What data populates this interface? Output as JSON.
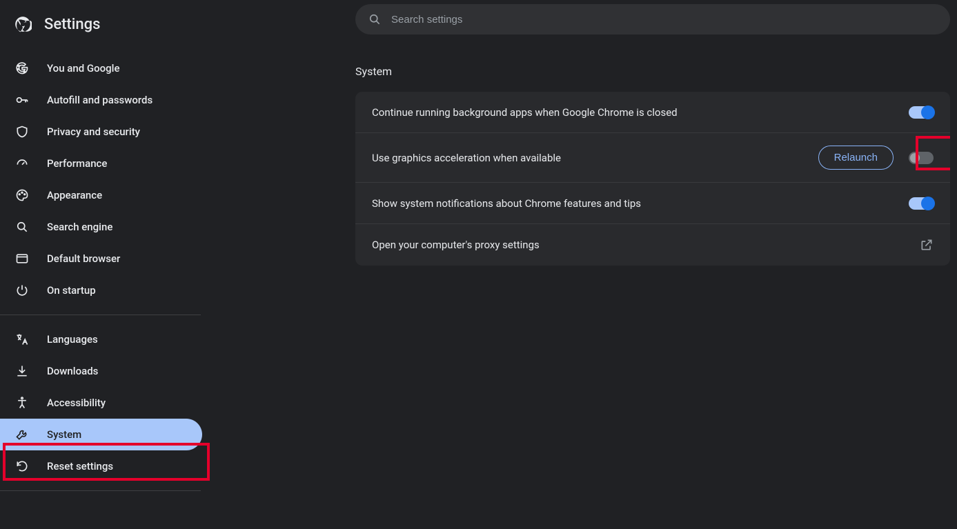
{
  "sidebar": {
    "title": "Settings",
    "groups": [
      {
        "items": [
          {
            "id": "you-google",
            "label": "You and Google",
            "icon": "google"
          },
          {
            "id": "autofill",
            "label": "Autofill and passwords",
            "icon": "key"
          },
          {
            "id": "privacy",
            "label": "Privacy and security",
            "icon": "shield"
          },
          {
            "id": "performance",
            "label": "Performance",
            "icon": "speedometer"
          },
          {
            "id": "appearance",
            "label": "Appearance",
            "icon": "palette"
          },
          {
            "id": "search-engine",
            "label": "Search engine",
            "icon": "search"
          },
          {
            "id": "default-browser",
            "label": "Default browser",
            "icon": "browser"
          },
          {
            "id": "on-startup",
            "label": "On startup",
            "icon": "power"
          }
        ]
      },
      {
        "items": [
          {
            "id": "languages",
            "label": "Languages",
            "icon": "translate"
          },
          {
            "id": "downloads",
            "label": "Downloads",
            "icon": "download"
          },
          {
            "id": "accessibility",
            "label": "Accessibility",
            "icon": "accessibility"
          },
          {
            "id": "system",
            "label": "System",
            "icon": "wrench",
            "selected": true
          },
          {
            "id": "reset",
            "label": "Reset settings",
            "icon": "reset"
          }
        ]
      }
    ]
  },
  "search": {
    "placeholder": "Search settings",
    "value": ""
  },
  "section": {
    "title": "System",
    "rows": {
      "bg_apps": {
        "label": "Continue running background apps when Google Chrome is closed",
        "toggle": "on"
      },
      "gpu": {
        "label": "Use graphics acceleration when available",
        "toggle": "off",
        "relaunch": "Relaunch"
      },
      "notifications": {
        "label": "Show system notifications about Chrome features and tips",
        "toggle": "on"
      },
      "proxy": {
        "label": "Open your computer's proxy settings"
      }
    }
  }
}
